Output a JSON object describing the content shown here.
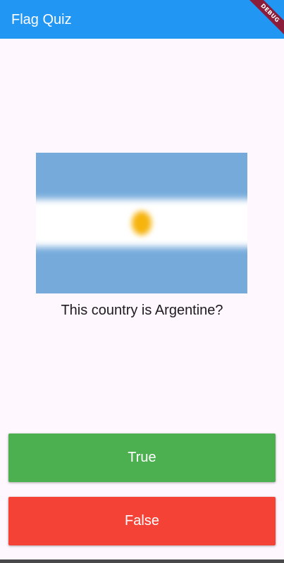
{
  "app_bar": {
    "title": "Flag Quiz",
    "color": "#2196F3"
  },
  "debug_banner": {
    "label": "DEBUG",
    "color": "#8B1C3A"
  },
  "flag": {
    "country": "Argentina",
    "stripe_colors": [
      "#75AADB",
      "#FFFFFF",
      "#75AADB"
    ],
    "sun_color": "#F6B40E"
  },
  "question": {
    "text": "This country is Argentine?"
  },
  "answers": {
    "true_label": "True",
    "true_color": "#4CAF50",
    "false_label": "False",
    "false_color": "#F44336"
  }
}
